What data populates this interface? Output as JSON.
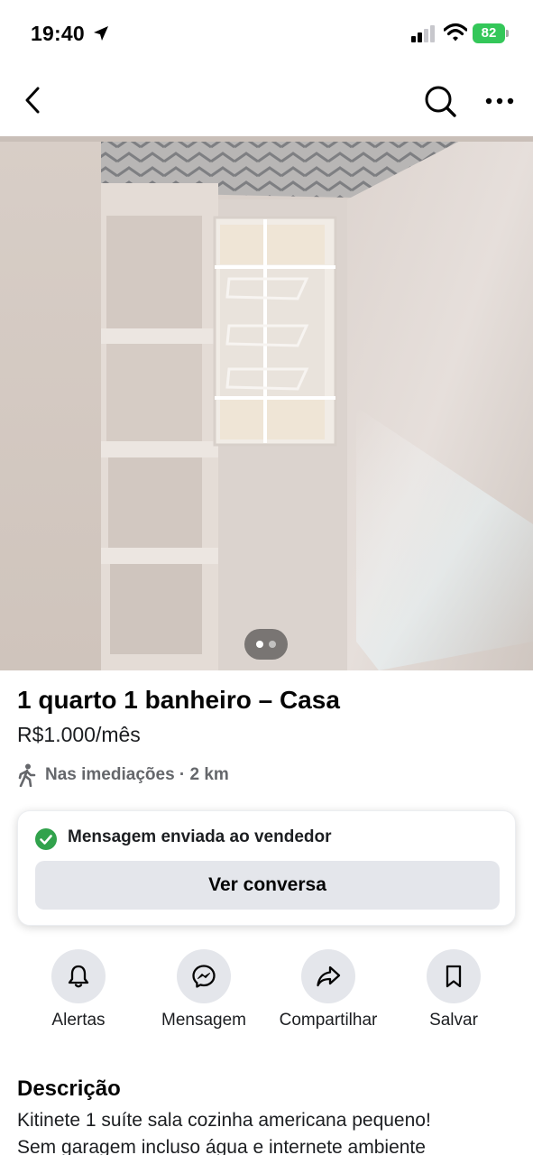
{
  "status_bar": {
    "time": "19:40",
    "battery": "82"
  },
  "nav": {
    "back_icon": "chevron-left-icon",
    "search_icon": "search-icon",
    "more_icon": "more-dots-icon"
  },
  "gallery": {
    "image_index": 1,
    "image_count": 2
  },
  "listing": {
    "title": "1 quarto 1 banheiro – Casa",
    "price": "R$1.000/mês",
    "location": "Nas imediações · 2 km"
  },
  "message_card": {
    "status": "Mensagem enviada ao vendedor",
    "button": "Ver conversa",
    "status_color": "#31a24c"
  },
  "actions": [
    {
      "label": "Alertas",
      "icon": "bell-icon"
    },
    {
      "label": "Mensagem",
      "icon": "messenger-icon"
    },
    {
      "label": "Compartilhar",
      "icon": "share-icon"
    },
    {
      "label": "Salvar",
      "icon": "bookmark-icon"
    }
  ],
  "description": {
    "heading": "Descrição",
    "lines": [
      "Kitinete 1 suíte sala cozinha americana pequeno!",
      "Sem garagem incluso água e internete ambiente"
    ]
  }
}
